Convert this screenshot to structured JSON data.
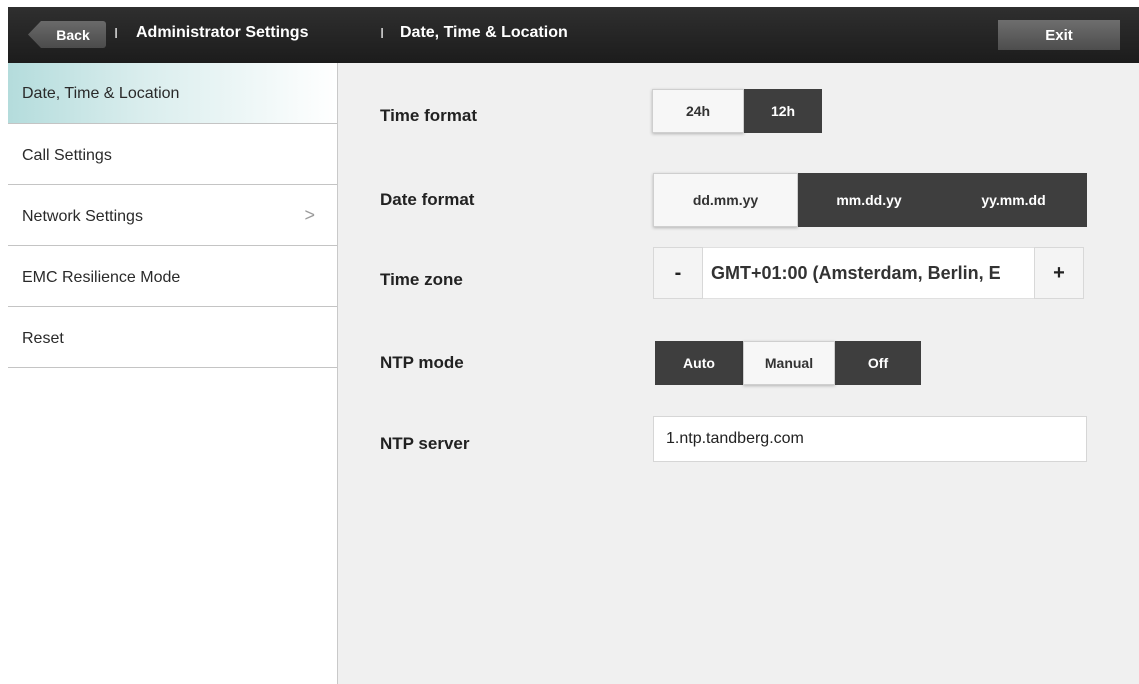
{
  "header": {
    "back_label": "Back",
    "separator": "I",
    "crumb_admin": "Administrator Settings",
    "crumb_page": "Date, Time & Location",
    "exit_label": "Exit"
  },
  "sidebar": {
    "items": [
      {
        "label": "Date, Time & Location",
        "active": true
      },
      {
        "label": "Call Settings"
      },
      {
        "label": "Network Settings",
        "chevron": ">"
      },
      {
        "label": "EMC Resilience Mode"
      },
      {
        "label": "Reset"
      }
    ]
  },
  "settings": {
    "time_format": {
      "label": "Time format",
      "options": [
        "24h",
        "12h"
      ],
      "selected": "24h"
    },
    "date_format": {
      "label": "Date format",
      "options": [
        "dd.mm.yy",
        "mm.dd.yy",
        "yy.mm.dd"
      ],
      "selected": "dd.mm.yy"
    },
    "time_zone": {
      "label": "Time zone",
      "value": "GMT+01:00 (Amsterdam, Berlin, E",
      "minus": "-",
      "plus": "+"
    },
    "ntp_mode": {
      "label": "NTP mode",
      "options": [
        "Auto",
        "Manual",
        "Off"
      ],
      "selected": "Manual"
    },
    "ntp_server": {
      "label": "NTP server",
      "value": "1.ntp.tandberg.com"
    }
  },
  "colors": {
    "header_bg": "#1c1c1c",
    "segment_dark": "#3e3e3e",
    "segment_selected": "#f7f7f7",
    "sidebar_active": "#b4dcdc",
    "content_bg": "#f0f0f0"
  }
}
